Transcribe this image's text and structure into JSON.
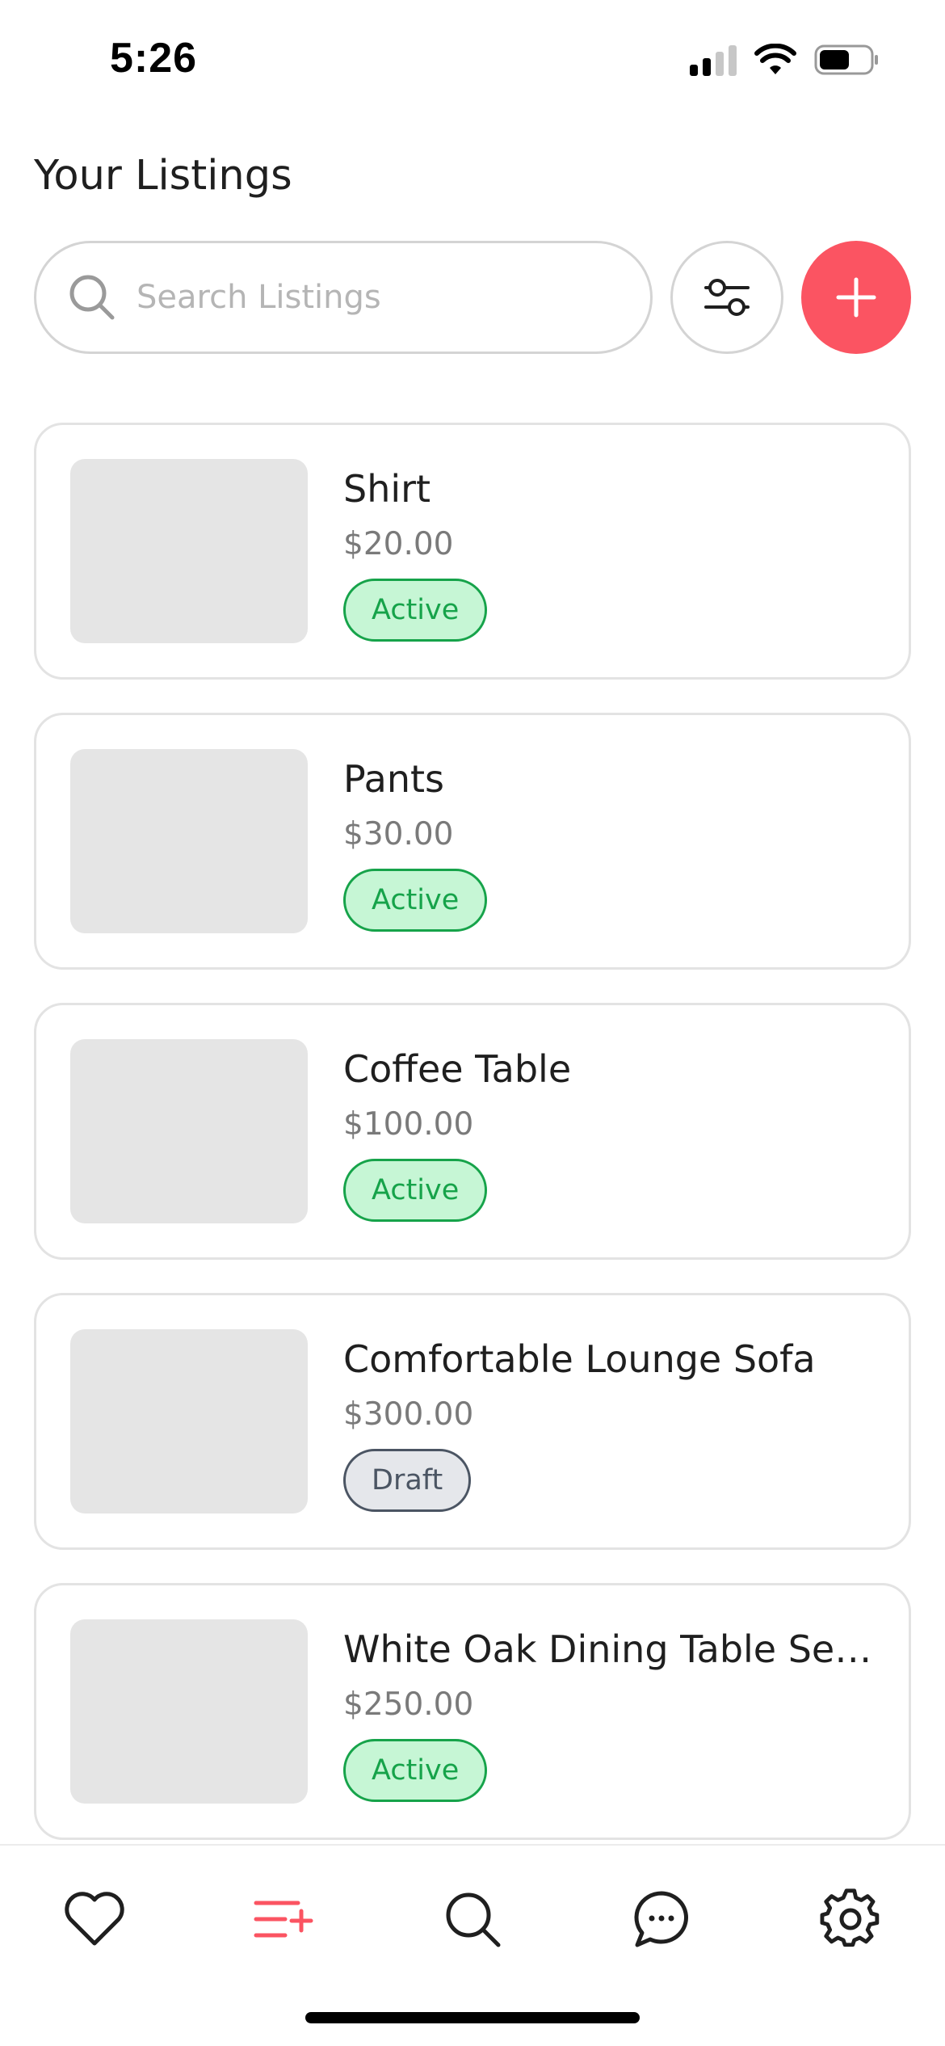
{
  "status_bar": {
    "time": "5:26",
    "icons": [
      "cellular-signal-icon",
      "wifi-icon",
      "battery-icon"
    ]
  },
  "header": {
    "title": "Your Listings"
  },
  "search": {
    "placeholder": "Search Listings",
    "value": ""
  },
  "actions": {
    "filter_icon": "sliders-icon",
    "add_icon": "plus-icon"
  },
  "listings": [
    {
      "name": "Shirt",
      "price": "$20.00",
      "status": "Active"
    },
    {
      "name": "Pants",
      "price": "$30.00",
      "status": "Active"
    },
    {
      "name": "Coffee Table",
      "price": "$100.00",
      "status": "Active"
    },
    {
      "name": "Comfortable Lounge Sofa",
      "price": "$300.00",
      "status": "Draft"
    },
    {
      "name": "White Oak Dining Table Se…",
      "price": "$250.00",
      "status": "Active"
    }
  ],
  "tab_bar": {
    "items": [
      {
        "icon": "heart-icon",
        "active": false
      },
      {
        "icon": "listings-add-icon",
        "active": true
      },
      {
        "icon": "search-icon",
        "active": false
      },
      {
        "icon": "chat-bubble-icon",
        "active": false
      },
      {
        "icon": "gear-icon",
        "active": false
      }
    ]
  },
  "colors": {
    "accent": "#fb5462",
    "active_badge_bg": "#c6f6d5",
    "active_badge_text": "#16a34a",
    "draft_badge_bg": "#e5e7eb",
    "draft_badge_text": "#4b5563",
    "thumbnail_placeholder": "#e5e5e5"
  }
}
